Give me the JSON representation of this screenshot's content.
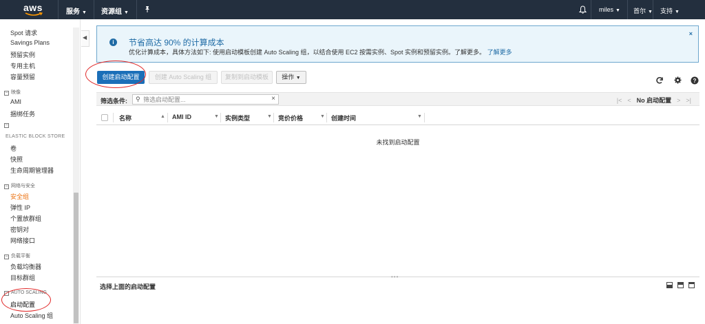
{
  "topnav": {
    "logo": "aws",
    "services": "服务",
    "resource_groups": "资源组",
    "user": "miles",
    "region": "首尔",
    "support": "支持"
  },
  "sidebar": {
    "items_top": [
      "Spot 请求",
      "Savings Plans",
      "预留实例",
      "专用主机",
      "容量预留"
    ],
    "section_images": "映像",
    "images_items": [
      "AMI",
      "捆绑任务"
    ],
    "heading_ebs": "ELASTIC BLOCK STORE",
    "ebs_items": [
      "卷",
      "快照",
      "生命周期管理器"
    ],
    "section_network": "网络与安全",
    "network_items": [
      "安全组",
      "弹性 IP",
      "个置放群组",
      "密钥对",
      "网络接口"
    ],
    "section_lb": "负载平衡",
    "lb_items": [
      "负载均衡器",
      "目标群组"
    ],
    "section_asg": "AUTO SCALING",
    "asg_items": [
      "启动配置",
      "Auto Scaling 组"
    ]
  },
  "banner": {
    "title": "节省高达 90% 的计算成本",
    "body": "优化计算成本，具体方法如下: 使用启动模板创建 Auto Scaling 组，以结合使用 EC2 按需实例、Spot 实例和预留实例。了解更多。",
    "link": "了解更多",
    "close": "×"
  },
  "toolbar": {
    "create": "创建启动配置",
    "create_asg": "创建 Auto Scaling 组",
    "copy_to_template": "复制到启动模板",
    "actions": "操作"
  },
  "filter": {
    "label": "筛选条件:",
    "placeholder": "筛选启动配置...",
    "pager_text": "No 启动配置"
  },
  "table": {
    "columns": [
      "名称",
      "AMI ID",
      "实例类型",
      "竞价价格",
      "创建时间"
    ],
    "empty": "未找到启动配置"
  },
  "detail": {
    "title": "选择上面的启动配置"
  }
}
